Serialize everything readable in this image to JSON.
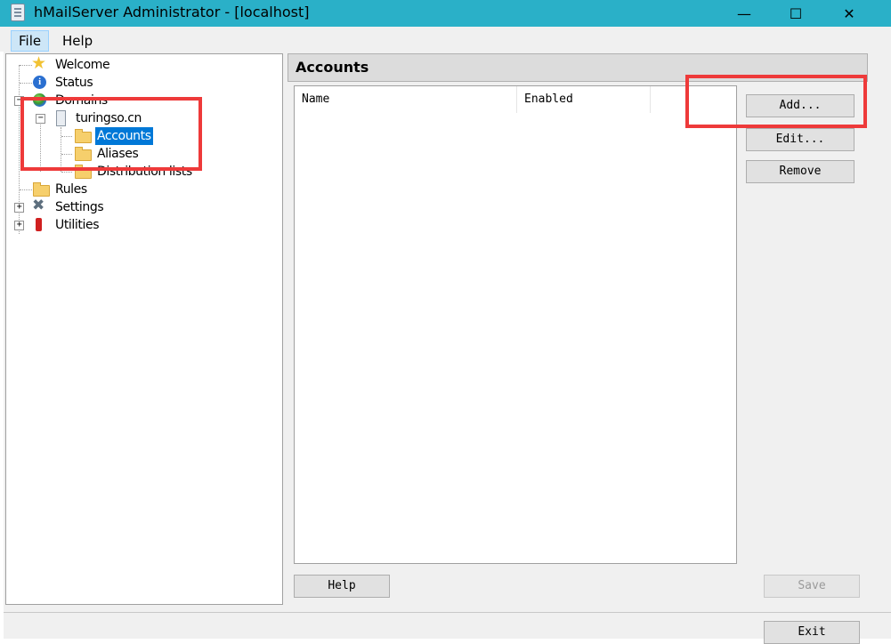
{
  "window": {
    "title": "hMailServer Administrator - [localhost]",
    "minimize_glyph": "—",
    "maximize_glyph": "☐",
    "close_glyph": "✕"
  },
  "menu": {
    "file": "File",
    "help": "Help"
  },
  "tree": {
    "welcome": "Welcome",
    "status": "Status",
    "domains": "Domains",
    "domain": "turingso.cn",
    "accounts": "Accounts",
    "aliases": "Aliases",
    "distribution_lists": "Distribution lists",
    "rules": "Rules",
    "settings": "Settings",
    "utilities": "Utilities",
    "collapse_glyph": "−",
    "expand_glyph": "+"
  },
  "panel": {
    "title": "Accounts",
    "columns": [
      "Name",
      "Enabled"
    ]
  },
  "buttons": {
    "add": "Add...",
    "edit": "Edit...",
    "remove": "Remove",
    "help": "Help",
    "save": "Save",
    "exit": "Exit"
  },
  "colors": {
    "titlebar": "#2ab0c8",
    "selection": "#0078d7",
    "highlight_box": "#ee3a3a"
  }
}
